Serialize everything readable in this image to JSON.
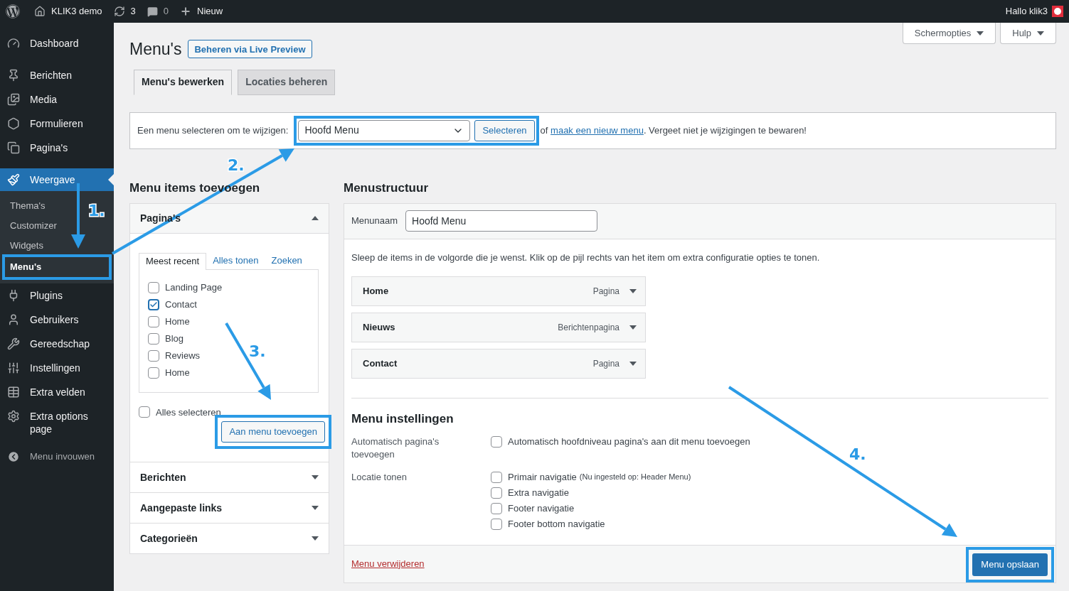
{
  "admin_bar": {
    "site": "KLIK3 demo",
    "updates": "3",
    "comments": "0",
    "new": "Nieuw",
    "greeting": "Hallo klik3"
  },
  "sidebar": {
    "items": [
      {
        "label": "Dashboard",
        "selected": false
      },
      {
        "label": "Berichten",
        "selected": false
      },
      {
        "label": "Media",
        "selected": false
      },
      {
        "label": "Formulieren",
        "selected": false
      },
      {
        "label": "Pagina's",
        "selected": false
      },
      {
        "label": "Weergave",
        "selected": true,
        "children": [
          {
            "label": "Thema's",
            "selected": false
          },
          {
            "label": "Customizer",
            "selected": false
          },
          {
            "label": "Widgets",
            "selected": false
          },
          {
            "label": "Menu's",
            "selected": true
          }
        ]
      },
      {
        "label": "Plugins",
        "selected": false
      },
      {
        "label": "Gebruikers",
        "selected": false
      },
      {
        "label": "Gereedschap",
        "selected": false
      },
      {
        "label": "Instellingen",
        "selected": false
      },
      {
        "label": "Extra velden",
        "selected": false
      },
      {
        "label": "Extra options page",
        "selected": false
      }
    ],
    "collapse": "Menu invouwen"
  },
  "screen_tabs": [
    "Schermopties",
    "Hulp"
  ],
  "page_title": "Menu's",
  "live_preview": "Beheren via Live Preview",
  "tabs": [
    {
      "label": "Menu's bewerken",
      "selected": true
    },
    {
      "label": "Locaties beheren",
      "selected": false
    }
  ],
  "select_bar": {
    "label": "Een menu selecteren om te wijzigen:",
    "value": "Hoofd Menu",
    "button": "Selecteren",
    "before": "of",
    "link": "maak een nieuw menu",
    "after": ". Vergeet niet je wijzigingen te bewaren!"
  },
  "add_items": {
    "heading": "Menu items toevoegen",
    "sections": [
      {
        "title": "Pagina's",
        "expanded": true,
        "tabs": [
          {
            "label": "Meest recent",
            "selected": true
          },
          {
            "label": "Alles tonen",
            "selected": false
          },
          {
            "label": "Zoeken",
            "selected": false
          }
        ],
        "items": [
          {
            "label": "Landing Page",
            "checked": false
          },
          {
            "label": "Contact",
            "checked": true
          },
          {
            "label": "Home",
            "checked": false
          },
          {
            "label": "Blog",
            "checked": false
          },
          {
            "label": "Reviews",
            "checked": false
          },
          {
            "label": "Home",
            "checked": false
          }
        ],
        "select_all": {
          "label": "Alles selecteren",
          "checked": false
        },
        "button": "Aan menu toevoegen"
      },
      {
        "title": "Berichten",
        "expanded": false
      },
      {
        "title": "Aangepaste links",
        "expanded": false
      },
      {
        "title": "Categorieën",
        "expanded": false
      }
    ]
  },
  "structure": {
    "heading": "Menustructuur",
    "name_label": "Menunaam",
    "name_value": "Hoofd Menu",
    "instructions": "Sleep de items in de volgorde die je wenst. Klik op de pijl rechts van het item om extra configuratie opties te tonen.",
    "items": [
      {
        "title": "Home",
        "type": "Pagina"
      },
      {
        "title": "Nieuws",
        "type": "Berichtenpagina"
      },
      {
        "title": "Contact",
        "type": "Pagina"
      }
    ],
    "settings_heading": "Menu instellingen",
    "auto_add": {
      "label": "Automatisch pagina's toevoegen",
      "option": "Automatisch hoofdniveau pagina's aan dit menu toevoegen",
      "checked": false
    },
    "locations": {
      "label": "Locatie tonen",
      "options": [
        {
          "label": "Primair navigatie",
          "note": "(Nu ingesteld op: Header Menu)",
          "checked": false
        },
        {
          "label": "Extra navigatie",
          "checked": false
        },
        {
          "label": "Footer navigatie",
          "checked": false
        },
        {
          "label": "Footer bottom navigatie",
          "checked": false
        }
      ]
    },
    "delete": "Menu verwijderen",
    "save": "Menu opslaan"
  },
  "annotations": [
    "1.",
    "2.",
    "3.",
    "4."
  ]
}
